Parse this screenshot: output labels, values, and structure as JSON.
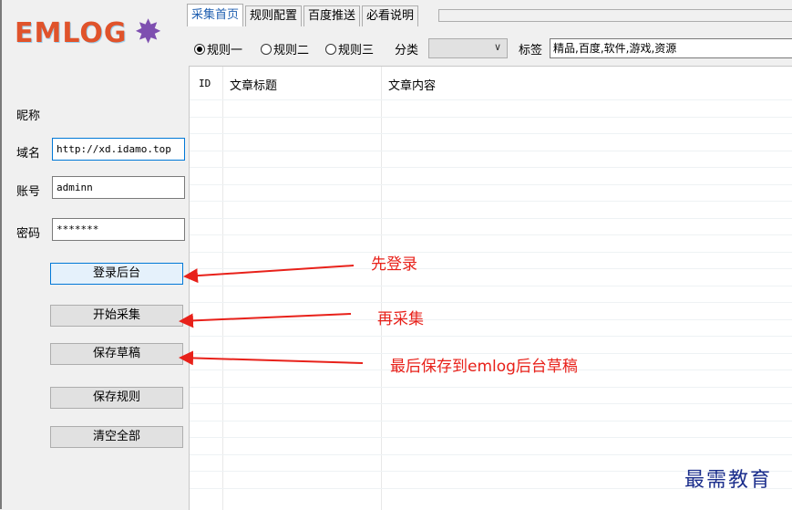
{
  "logo": {
    "text": "EMLOG",
    "icon": "maple-leaf-icon",
    "text_color": "#e0532b",
    "leaf_color": "#7e4fb0"
  },
  "left": {
    "nickname_label": "昵称",
    "domain_label": "域名",
    "domain_value": "http://xd.idamo.top",
    "account_label": "账号",
    "account_value": "adminn",
    "password_label": "密码",
    "password_value": "*******",
    "buttons": {
      "login": "登录后台",
      "start": "开始采集",
      "save_draft": "保存草稿",
      "save_rules": "保存规则",
      "clear_all": "清空全部"
    }
  },
  "tabs": [
    {
      "label": "采集首页",
      "active": true
    },
    {
      "label": "规则配置",
      "active": false
    },
    {
      "label": "百度推送",
      "active": false
    },
    {
      "label": "必看说明",
      "active": false
    }
  ],
  "toolbar": {
    "rules": [
      "规则一",
      "规则二",
      "规则三"
    ],
    "selected_rule": "规则一",
    "category_label": "分类",
    "category_value": "",
    "tags_label": "标签",
    "tags_value": "精品,百度,软件,游戏,资源"
  },
  "table": {
    "columns": [
      "ID",
      "文章标题",
      "文章内容"
    ],
    "rows": []
  },
  "annotations": {
    "step1": "先登录",
    "step2": "再采集",
    "step3": "最后保存到emlog后台草稿",
    "color": "#e8211a"
  },
  "watermark": "最需教育"
}
